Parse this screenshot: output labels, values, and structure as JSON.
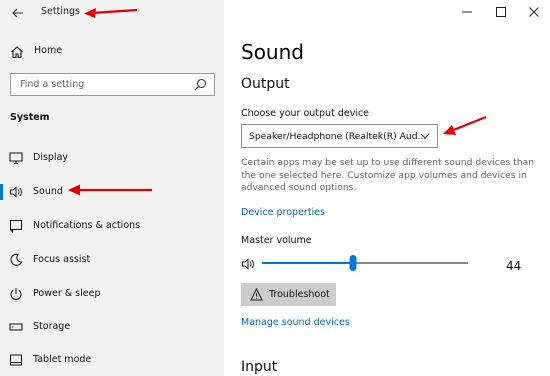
{
  "app": {
    "title": "Settings",
    "back_glyph": "←"
  },
  "nav": {
    "home_label": "Home",
    "search_placeholder": "Find a setting",
    "section_header": "System",
    "items": [
      {
        "label": "Display",
        "icon": "display-icon",
        "active": false
      },
      {
        "label": "Sound",
        "icon": "speaker-icon",
        "active": true
      },
      {
        "label": "Notifications & actions",
        "icon": "notifications-icon",
        "active": false
      },
      {
        "label": "Focus assist",
        "icon": "moon-icon",
        "active": false
      },
      {
        "label": "Power & sleep",
        "icon": "power-icon",
        "active": false
      },
      {
        "label": "Storage",
        "icon": "storage-icon",
        "active": false
      },
      {
        "label": "Tablet mode",
        "icon": "tablet-icon",
        "active": false
      }
    ]
  },
  "page": {
    "title": "Sound",
    "output": {
      "heading": "Output",
      "choose_label": "Choose your output device",
      "device_value": "Speaker/Headphone (Realtek(R) Aud...",
      "description": "Certain apps may be set up to use different sound devices than the one selected here. Customize app volumes and devices in advanced sound options.",
      "device_properties_link": "Device properties",
      "master_volume_label": "Master volume",
      "volume": 44,
      "volume_display": "44",
      "troubleshoot_label": "Troubleshoot",
      "manage_devices_link": "Manage sound devices"
    },
    "input": {
      "heading": "Input"
    }
  },
  "colors": {
    "accent": "#0078d4",
    "link": "#0067c0",
    "nav_bg": "#f2f2f2",
    "annotation_arrow": "#e00000"
  }
}
